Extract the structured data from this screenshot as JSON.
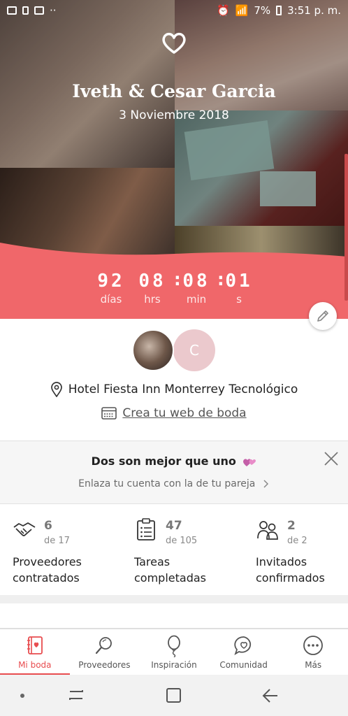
{
  "status_bar": {
    "battery": "7%",
    "time": "3:51 p. m."
  },
  "hero": {
    "couple_name": "Iveth & Cesar Garcia",
    "wedding_date": "3 Noviembre 2018"
  },
  "countdown": {
    "days": {
      "value": "92",
      "label": "días"
    },
    "hours": {
      "value": "08",
      "label": "hrs"
    },
    "minutes": {
      "value": "08",
      "label": "min"
    },
    "seconds": {
      "value": "01",
      "label": "s"
    }
  },
  "partner_avatar_initial": "C",
  "venue": "Hotel Fiesta Inn Monterrey Tecnológico",
  "web_link": "Crea tu web de boda",
  "partner_banner": {
    "title": "Dos son mejor que uno",
    "subtitle": "Enlaza tu cuenta con la de tu pareja"
  },
  "stats": [
    {
      "count": "6",
      "of": "de 17",
      "label_line1": "Proveedores",
      "label_line2": "contratados",
      "icon": "handshake-icon"
    },
    {
      "count": "47",
      "of": "de 105",
      "label_line1": "Tareas",
      "label_line2": "completadas",
      "icon": "clipboard-icon"
    },
    {
      "count": "2",
      "of": "de 2",
      "label_line1": "Invitados",
      "label_line2": "confirmados",
      "icon": "guests-icon"
    }
  ],
  "bottom_nav": [
    {
      "label": "Mi boda",
      "icon": "notebook-icon",
      "active": true
    },
    {
      "label": "Proveedores",
      "icon": "search-icon",
      "active": false
    },
    {
      "label": "Inspiración",
      "icon": "balloon-icon",
      "active": false
    },
    {
      "label": "Comunidad",
      "icon": "chat-heart-icon",
      "active": false
    },
    {
      "label": "Más",
      "icon": "more-icon",
      "active": false
    }
  ],
  "colors": {
    "accent": "#F0676A",
    "active": "#E84C4F"
  }
}
